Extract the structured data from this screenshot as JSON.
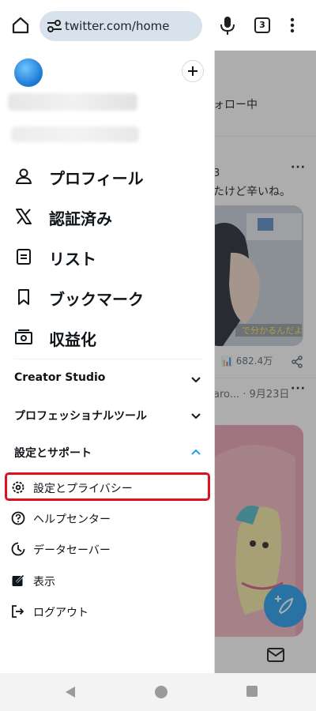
{
  "browser": {
    "url": "twitter.com/home",
    "tab_count": "3"
  },
  "drawer": {
    "nav": [
      {
        "label": "プロフィール",
        "icon": "person-icon"
      },
      {
        "label": "認証済み",
        "icon": "x-logo-icon"
      },
      {
        "label": "リスト",
        "icon": "list-icon"
      },
      {
        "label": "ブックマーク",
        "icon": "bookmark-icon"
      },
      {
        "label": "収益化",
        "icon": "monetization-icon"
      }
    ],
    "sections": {
      "creator_studio": "Creator Studio",
      "professional_tools": "プロフェッショナルツール",
      "settings_support": "設定とサポート"
    },
    "settings_items": [
      {
        "label": "設定とプライバシー",
        "icon": "gear-icon"
      },
      {
        "label": "ヘルプセンター",
        "icon": "help-circle-icon"
      },
      {
        "label": "データセーバー",
        "icon": "data-saver-icon"
      },
      {
        "label": "表示",
        "icon": "edit-display-icon"
      },
      {
        "label": "ログアウト",
        "icon": "logout-icon"
      }
    ]
  },
  "timeline": {
    "following_tab": "ォロー中",
    "tweet_fragment": "たけど辛いね。",
    "tweet_number": "3",
    "image_caption": "で分かるんだよ",
    "views": "682.4万",
    "meta": "aro... · 9月23日"
  },
  "colors": {
    "highlight": "#e0121b",
    "accent": "#1d9bf0"
  }
}
